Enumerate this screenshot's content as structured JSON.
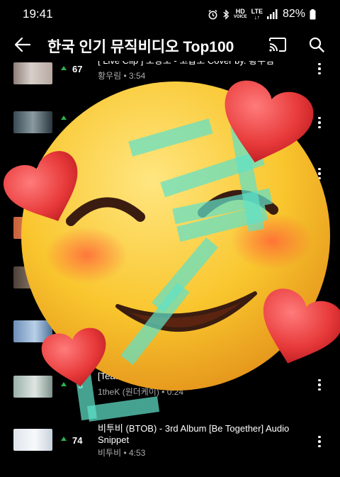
{
  "status_bar": {
    "time": "19:41",
    "hd_label": "HD",
    "voice_label": "VOICE",
    "lte_label": "LTE",
    "battery": "82%"
  },
  "app_bar": {
    "title": "한국 인기 뮤직비디오 Top100",
    "icons": [
      "back-arrow-icon",
      "cast-icon",
      "search-icon"
    ]
  },
  "videos": [
    {
      "rank": "67",
      "trend": "up",
      "title": "[ Live Clip ] 조광조 - 고갑조 Cover by. 황우림",
      "meta": "황우림 • 3:54"
    },
    {
      "rank": "",
      "trend": "up",
      "title": "",
      "meta": ""
    },
    {
      "rank": "",
      "trend": "",
      "title": "",
      "meta": ""
    },
    {
      "rank": "",
      "trend": "",
      "title": "",
      "meta": ""
    },
    {
      "rank": "",
      "trend": "",
      "title": "",
      "meta": ""
    },
    {
      "rank": "",
      "trend": "",
      "title": "",
      "meta": ""
    },
    {
      "rank": "3",
      "trend": "up",
      "title": "[Teas",
      "meta": "1theK (원더케이) • 0:24"
    },
    {
      "rank": "74",
      "trend": "up",
      "title": "비투비 (BTOB) - 3rd Album [Be Together] Audio Snippet",
      "meta": "비투비 • 4:53"
    }
  ],
  "sticker": {
    "type": "smiling-emoji-with-hearts",
    "heart_color": "#e83a3a",
    "face_color": "#f6c42b",
    "overlay_text": "좋아요",
    "overlay_color": "#5fe0c8"
  }
}
